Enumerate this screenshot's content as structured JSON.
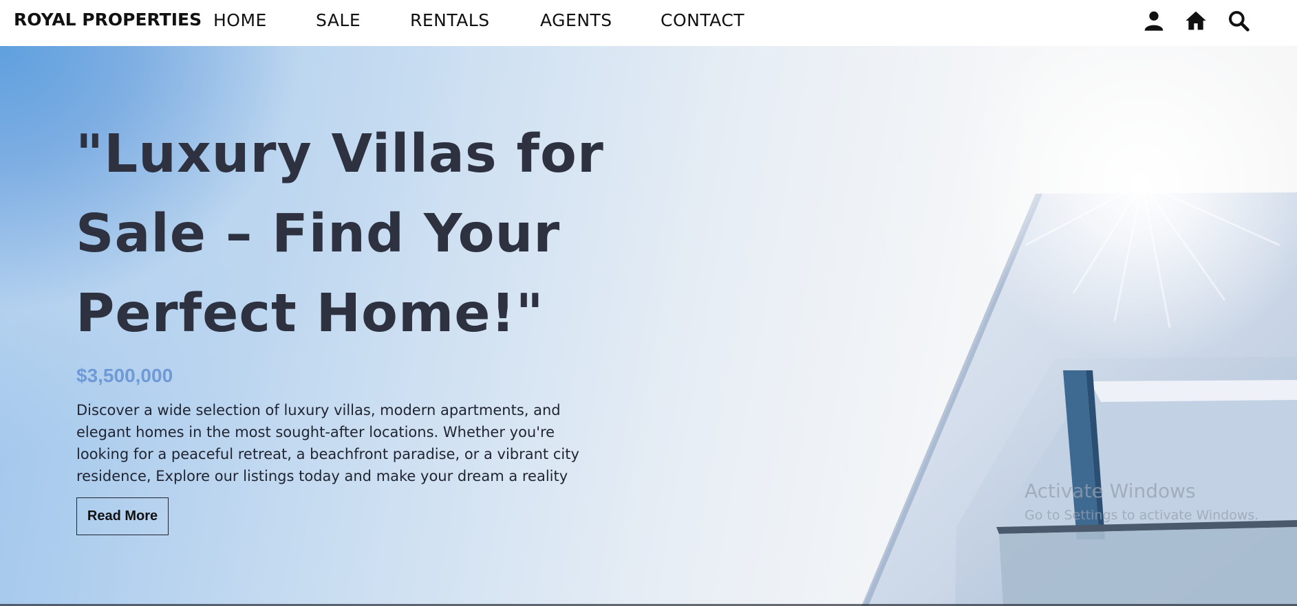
{
  "nav": {
    "brand": "ROYAL PROPERTIES",
    "links": [
      "HOME",
      "SALE",
      "RENTALS",
      "AGENTS",
      "CONTACT"
    ],
    "icons": [
      "user-icon",
      "home-icon",
      "search-icon"
    ]
  },
  "hero": {
    "title": "\"Luxury Villas for Sale – Find Your Perfect Home!\"",
    "price": "$3,500,000",
    "description": "Discover a wide selection of luxury villas, modern apartments, and elegant homes in the most sought-after locations. Whether you're looking for a peaceful retreat, a beachfront paradise, or a vibrant city residence, Explore our listings today and make your dream a reality",
    "button_label": "Read More"
  },
  "watermark": {
    "title": "Activate Windows",
    "subtitle": "Go to Settings to activate Windows."
  },
  "colors": {
    "accent": "#6f9ad6",
    "text": "#2e3240"
  }
}
